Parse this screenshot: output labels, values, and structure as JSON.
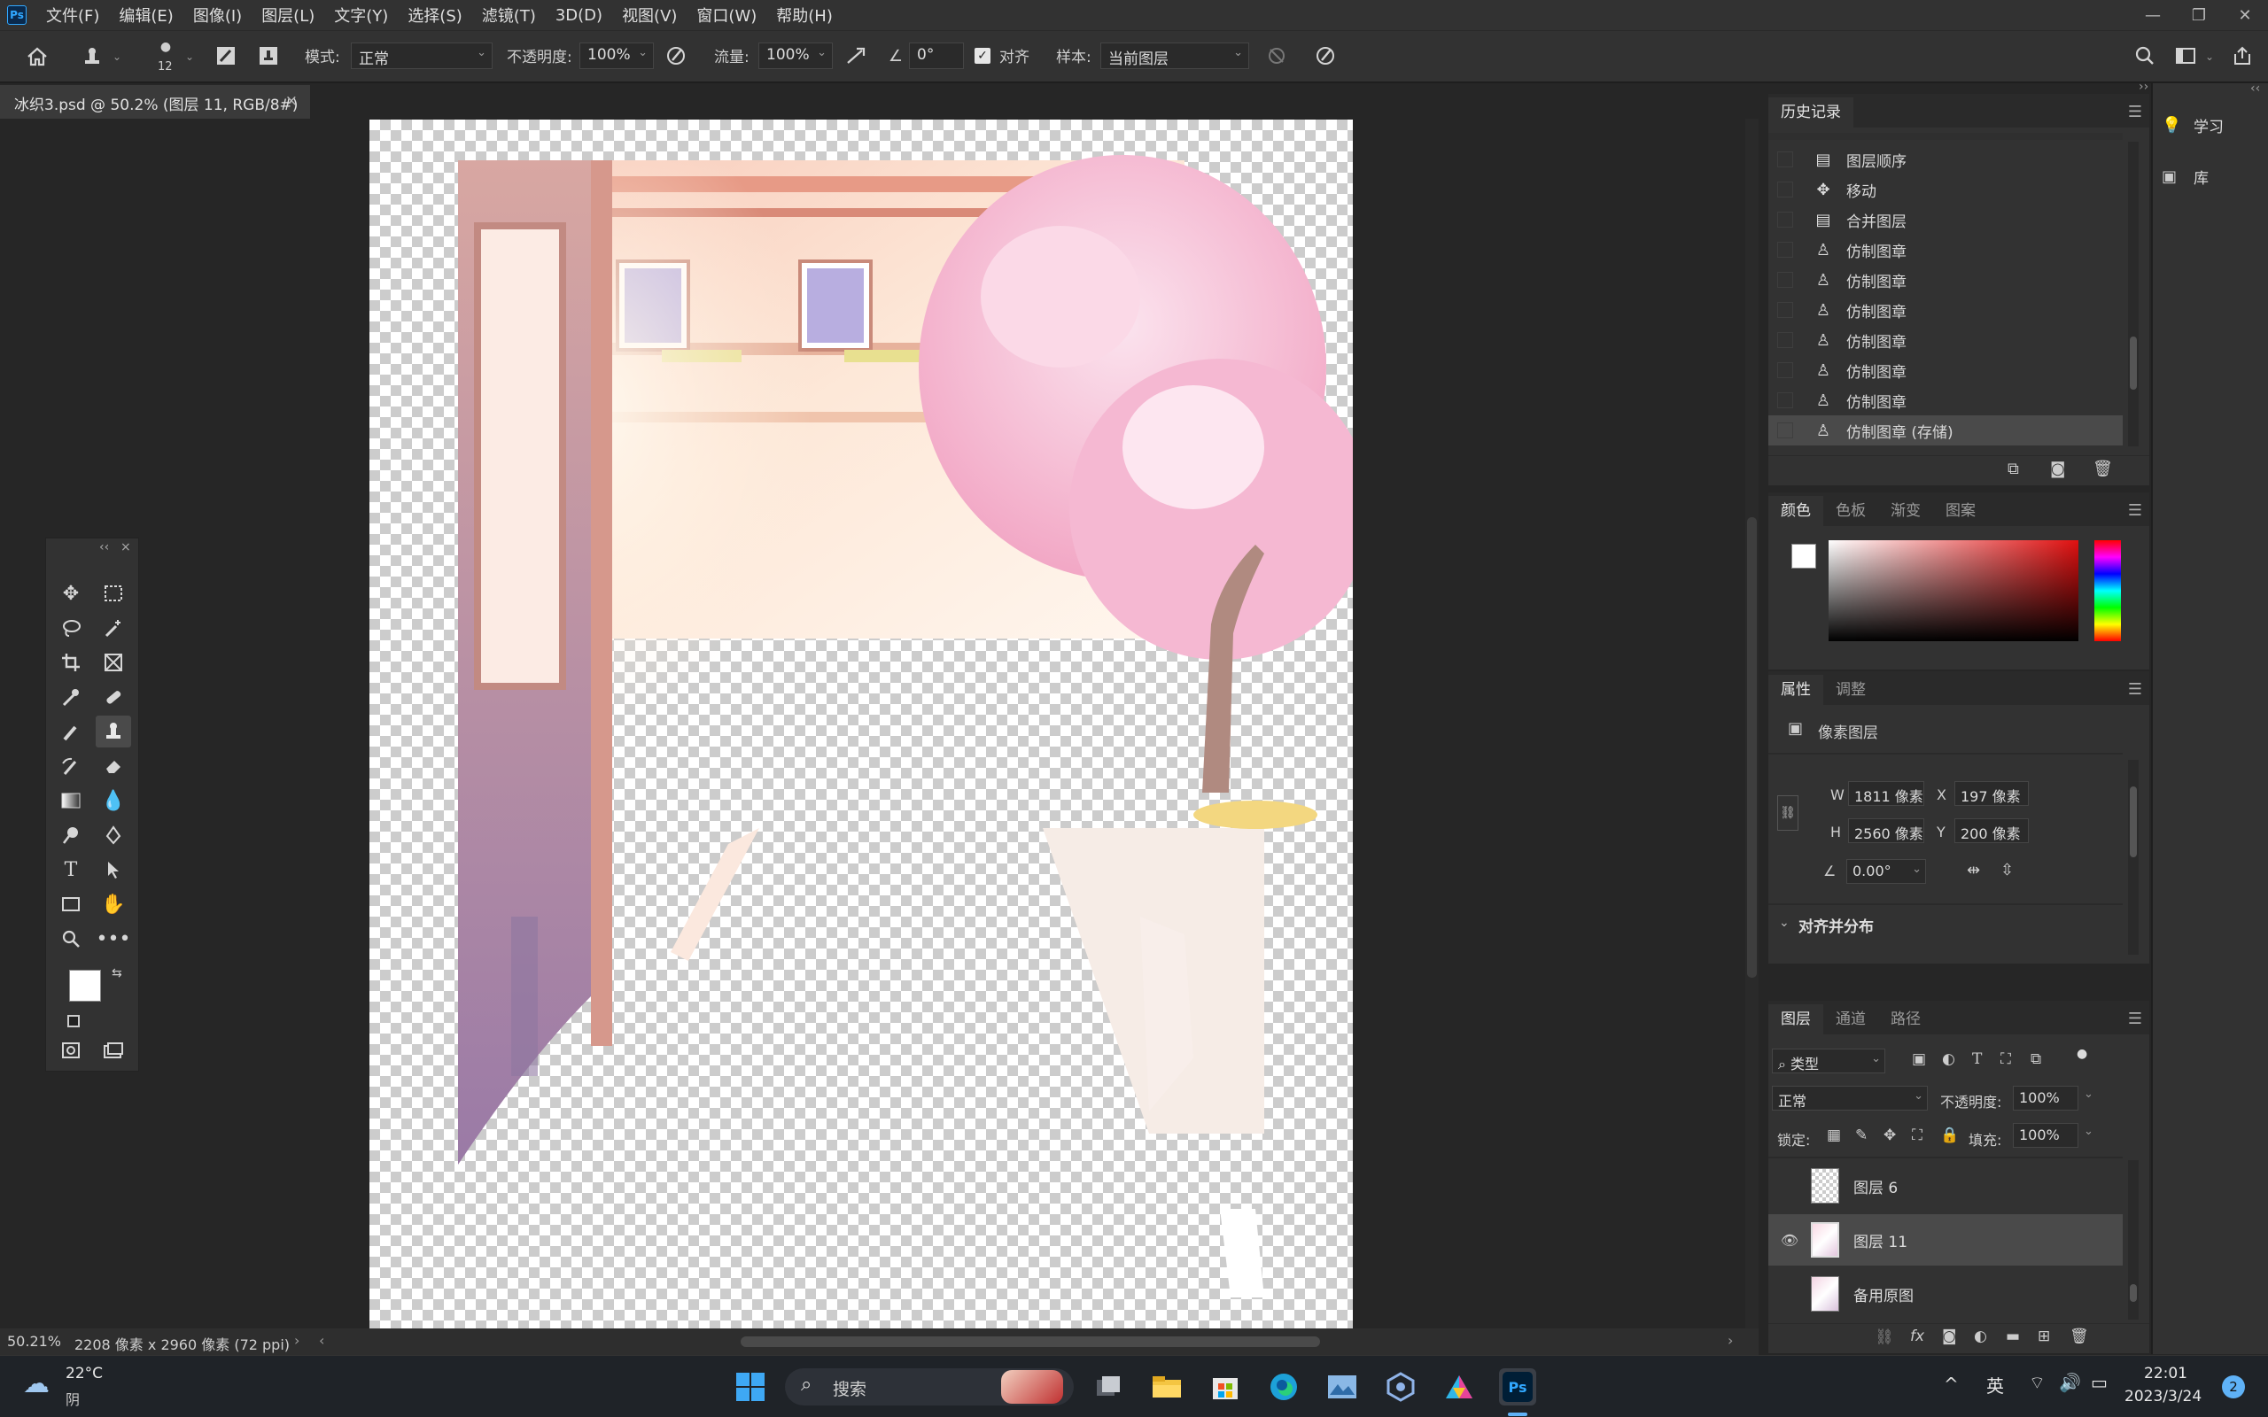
{
  "menubar": {
    "logo": "Ps",
    "items": [
      "文件(F)",
      "编辑(E)",
      "图像(I)",
      "图层(L)",
      "文字(Y)",
      "选择(S)",
      "滤镜(T)",
      "3D(D)",
      "视图(V)",
      "窗口(W)",
      "帮助(H)"
    ]
  },
  "options": {
    "brush_size": "12",
    "mode_label": "模式:",
    "mode_value": "正常",
    "opacity_label": "不透明度:",
    "opacity_value": "100%",
    "flow_label": "流量:",
    "flow_value": "100%",
    "angle_value": "0°",
    "align_label": "对齐",
    "align_checked": true,
    "sample_label": "样本:",
    "sample_value": "当前图层"
  },
  "document": {
    "tab_title": "冰织3.psd @ 50.2% (图层 11, RGB/8#)"
  },
  "status": {
    "zoom": "50.21%",
    "doc_info": "2208 像素 x 2960 像素 (72 ppi)"
  },
  "history": {
    "tab": "历史记录",
    "items": [
      {
        "icon": "doc-icon",
        "label": "图层顺序"
      },
      {
        "icon": "move-icon",
        "label": "移动"
      },
      {
        "icon": "doc-icon",
        "label": "合并图层"
      },
      {
        "icon": "stamp-icon",
        "label": "仿制图章"
      },
      {
        "icon": "stamp-icon",
        "label": "仿制图章"
      },
      {
        "icon": "stamp-icon",
        "label": "仿制图章"
      },
      {
        "icon": "stamp-icon",
        "label": "仿制图章"
      },
      {
        "icon": "stamp-icon",
        "label": "仿制图章"
      },
      {
        "icon": "stamp-icon",
        "label": "仿制图章"
      },
      {
        "icon": "stamp-icon",
        "label": "仿制图章 (存储)"
      }
    ]
  },
  "color_panel": {
    "tabs": [
      "颜色",
      "色板",
      "渐变",
      "图案"
    ],
    "hue_color": "#e01010"
  },
  "properties": {
    "tabs": [
      "属性",
      "调整"
    ],
    "kind": "像素图层",
    "w": "1811 像素",
    "h": "2560 像素",
    "x": "197 像素",
    "y": "200 像素",
    "angle": "0.00°",
    "section": "对齐并分布"
  },
  "layers": {
    "tabs": [
      "图层",
      "通道",
      "路径"
    ],
    "filter": "类型",
    "blend": "正常",
    "opacity_label": "不透明度:",
    "opacity": "100%",
    "lock_label": "锁定:",
    "fill_label": "填充:",
    "fill": "100%",
    "items": [
      {
        "name": "图层 6",
        "visible": false,
        "selected": false
      },
      {
        "name": "图层 11",
        "visible": true,
        "selected": true
      },
      {
        "name": "备用原图",
        "visible": false,
        "selected": false
      }
    ]
  },
  "rightpanel": {
    "items": [
      "学习",
      "库"
    ]
  },
  "taskbar": {
    "weather_temp": "22°C",
    "weather_desc": "阴",
    "search_placeholder": "搜索",
    "ime": "英",
    "time": "22:01",
    "date": "2023/3/24",
    "notif_count": "2"
  }
}
